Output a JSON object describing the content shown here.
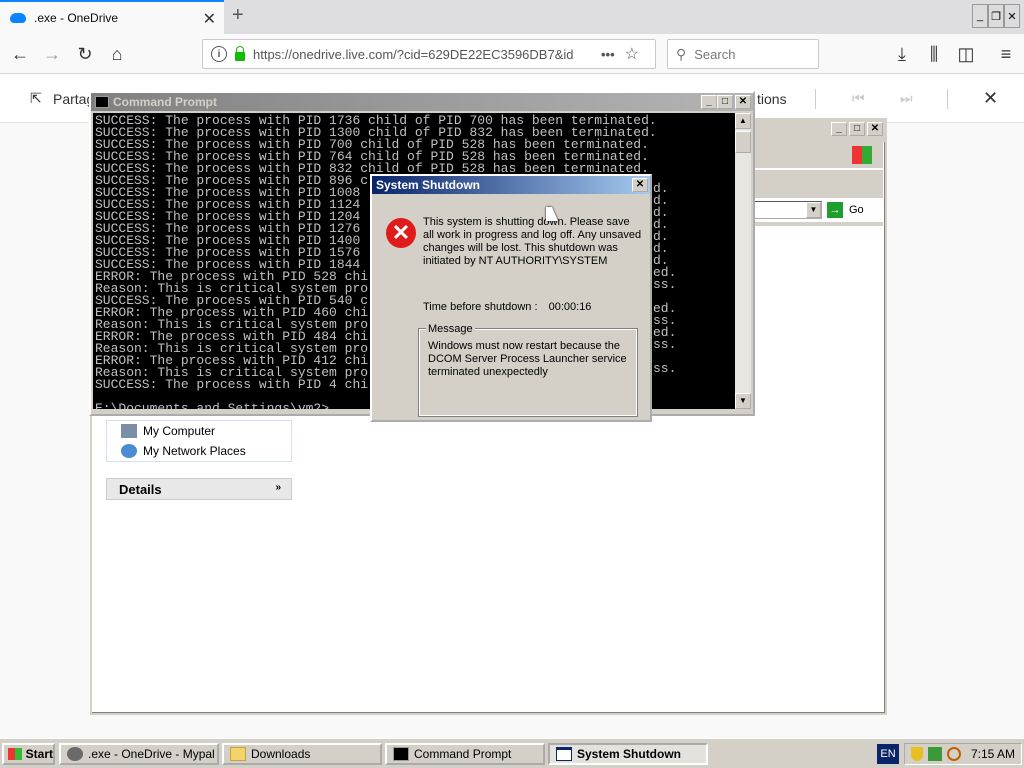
{
  "browser": {
    "tab_title": ".exe - OneDrive",
    "url": "https://onedrive.live.com/?cid=629DE22EC3596DB7&id",
    "search_placeholder": "Search"
  },
  "page": {
    "share_label": "Partag",
    "options_label": "tions"
  },
  "explorer": {
    "go_label": "Go",
    "task_items": [
      {
        "label": "My Computer"
      },
      {
        "label": "My Network Places"
      }
    ],
    "details_label": "Details"
  },
  "cmd": {
    "title": "Command Prompt",
    "lines": [
      "SUCCESS: The process with PID 1736 child of PID 700 has been terminated.",
      "SUCCESS: The process with PID 1300 child of PID 832 has been terminated.",
      "SUCCESS: The process with PID 700 child of PID 528 has been terminated.",
      "SUCCESS: The process with PID 764 child of PID 528 has been terminated.",
      "SUCCESS: The process with PID 832 child of PID 528 has been terminated.",
      "SUCCESS: The process with PID 896 c",
      "SUCCESS: The process with PID 1008",
      "SUCCESS: The process with PID 1124",
      "SUCCESS: The process with PID 1204",
      "SUCCESS: The process with PID 1276",
      "SUCCESS: The process with PID 1400",
      "SUCCESS: The process with PID 1576",
      "SUCCESS: The process with PID 1844",
      "ERROR: The process with PID 528 chi",
      "Reason: This is critical system pro",
      "SUCCESS: The process with PID 540 c",
      "ERROR: The process with PID 460 chi",
      "Reason: This is critical system pro",
      "ERROR: The process with PID 484 chi",
      "Reason: This is critical system pro",
      "ERROR: The process with PID 412 chi",
      "Reason: This is critical system pro",
      "SUCCESS: The process with PID 4 chi",
      "",
      "E:\\Documents and Settings\\vm2>"
    ],
    "right_tails": [
      "d.",
      "d.",
      "d.",
      "d.",
      "d.",
      "d.",
      "d.",
      "ed.",
      "ss.",
      "",
      "ed.",
      "ss.",
      "ed.",
      "ss.",
      "",
      "ss."
    ]
  },
  "dialog": {
    "title": "System Shutdown",
    "message": "This system is shutting down. Please save all work in progress and log off. Any unsaved changes will be lost. This shutdown was initiated by NT AUTHORITY\\SYSTEM",
    "time_label": "Time before shutdown :",
    "time_value": "00:00:16",
    "group_label": "Message",
    "group_text": "Windows must now restart because the DCOM Server Process Launcher service terminated unexpectedly"
  },
  "taskbar": {
    "start_label": "Start",
    "items": [
      {
        "label": ".exe - OneDrive - Mypal"
      },
      {
        "label": "Downloads"
      },
      {
        "label": "Command Prompt"
      },
      {
        "label": "System Shutdown"
      }
    ],
    "lang": "EN",
    "clock": "7:15 AM"
  }
}
